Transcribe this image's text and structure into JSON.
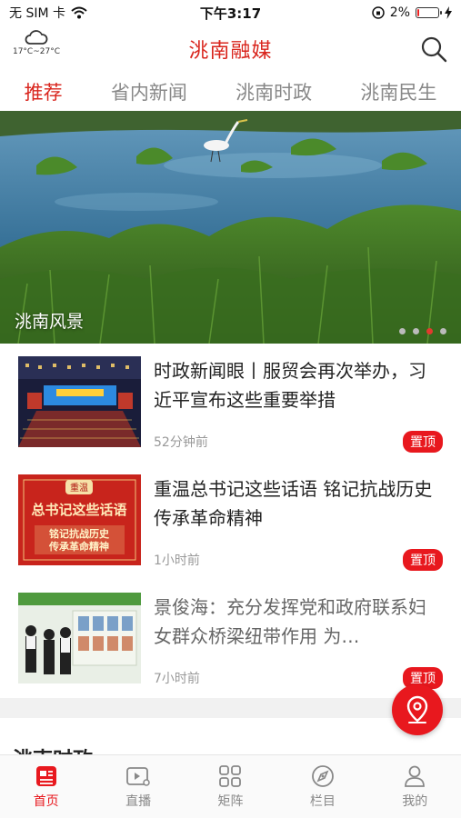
{
  "status_bar": {
    "carrier": "无 SIM 卡",
    "time": "下午3:17",
    "battery": "2%",
    "battery_level": 0.02
  },
  "header": {
    "weather_temp": "17°C~27°C",
    "title": "洮南融媒",
    "weather_icon": "cloud-icon",
    "search_icon": "search-icon"
  },
  "tabs": [
    {
      "label": "推荐",
      "active": true
    },
    {
      "label": "省内新闻",
      "active": false
    },
    {
      "label": "洮南时政",
      "active": false
    },
    {
      "label": "洮南民生",
      "active": false
    }
  ],
  "banner": {
    "caption": "洮南风景",
    "slide_count": 4,
    "active_slide": 3
  },
  "news": [
    {
      "title": "时政新闻眼丨服贸会再次举办，习近平宣布这些重要举措",
      "time": "52分钟前",
      "pin": "置顶"
    },
    {
      "title": "重温总书记这些话语 铭记抗战历史传承革命精神",
      "time": "1小时前",
      "pin": "置顶",
      "thumb_tag": "重温",
      "thumb_line1": "总书记这些话语",
      "thumb_line2": "铭记抗战历史",
      "thumb_line3": "传承革命精神"
    },
    {
      "title": "景俊海：充分发挥党和政府联系妇女群众桥梁纽带作用 为…",
      "time": "7小时前",
      "pin": "置顶"
    }
  ],
  "section_peek": {
    "title": "洮南时政"
  },
  "tabbar": [
    {
      "label": "首页",
      "icon": "home-news-icon",
      "active": true
    },
    {
      "label": "直播",
      "icon": "live-video-icon",
      "active": false
    },
    {
      "label": "矩阵",
      "icon": "grid-icon",
      "active": false
    },
    {
      "label": "栏目",
      "icon": "column-compass-icon",
      "active": false
    },
    {
      "label": "我的",
      "icon": "user-icon",
      "active": false
    }
  ],
  "colors": {
    "accent": "#d9251d",
    "pin": "#e8181e"
  }
}
